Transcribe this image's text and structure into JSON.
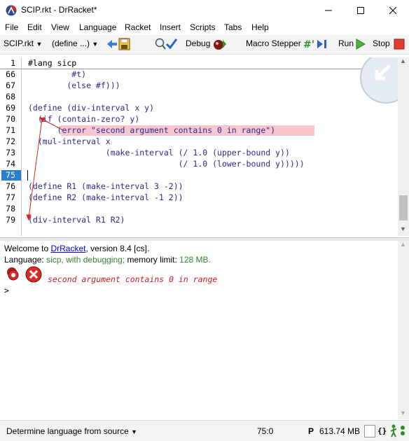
{
  "window": {
    "title": "SCIP.rkt - DrRacket*"
  },
  "menu": [
    "File",
    "Edit",
    "View",
    "Language",
    "Racket",
    "Insert",
    "Scripts",
    "Tabs",
    "Help"
  ],
  "toolbar": {
    "file_dropdown": "SCIP.rkt",
    "define_dropdown": "(define ...)",
    "debug_label": "Debug",
    "macro_stepper_label": "Macro Stepper",
    "run_label": "Run",
    "stop_label": "Stop"
  },
  "editor": {
    "lines": [
      {
        "num": "1",
        "text": "#lang sicp"
      },
      {
        "num": "66",
        "text": "         #t)"
      },
      {
        "num": "67",
        "text": "        (else #f)))"
      },
      {
        "num": "68",
        "text": ""
      },
      {
        "num": "69",
        "text": "(define (div-interval x y)"
      },
      {
        "num": "70",
        "text": "  (if (contain-zero? y)"
      },
      {
        "num": "71",
        "text": "      (error \"second argument contains 0 in range\")"
      },
      {
        "num": "72",
        "text": "  (mul-interval x"
      },
      {
        "num": "73",
        "text": "                (make-interval (/ 1.0 (upper-bound y))"
      },
      {
        "num": "74",
        "text": "                               (/ 1.0 (lower-bound y)))))"
      },
      {
        "num": "75",
        "text": ""
      },
      {
        "num": "76",
        "text": "(define R1 (make-interval 3 -2))"
      },
      {
        "num": "77",
        "text": "(define R2 (make-interval -1 2))"
      },
      {
        "num": "78",
        "text": ""
      },
      {
        "num": "79",
        "text": "(div-interval R1 R2)"
      }
    ],
    "error_line": "71",
    "current_line": "75"
  },
  "repl": {
    "welcome_prefix": "Welcome to ",
    "welcome_link": "DrRacket",
    "welcome_suffix": ", version 8.4 [cs].",
    "language_prefix": "Language: ",
    "language_name": "sicp, with debugging;",
    "memory_prefix": " memory limit: ",
    "memory_value": "128 MB.",
    "error_message": "second argument contains 0 in range",
    "prompt": ">"
  },
  "status": {
    "language_selector": "Determine language from source",
    "position": "75:0",
    "p_indicator": "P",
    "memory": "613.74 MB",
    "braces": "{}"
  },
  "colors": {
    "code": "#2b2b8f",
    "error_highlight": "#f7c6cf",
    "error_text": "#cc1f1f",
    "language_green": "#2e8b2e",
    "current_line": "#2a7fd1"
  }
}
